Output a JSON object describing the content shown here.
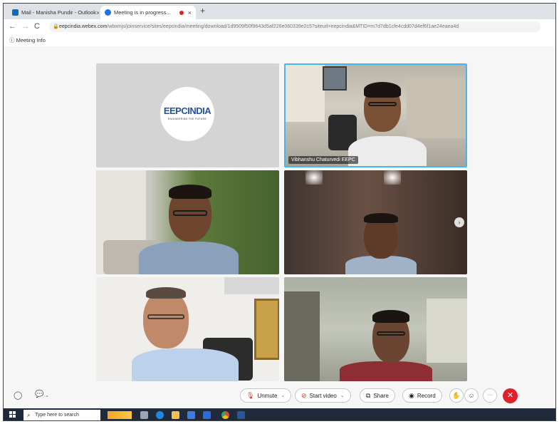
{
  "browser": {
    "tabs": [
      {
        "label": "Mail - Manisha Pundir - Outlook",
        "close": "×"
      },
      {
        "label": "Meeting is in progress...",
        "close": "×"
      }
    ],
    "new_tab": "+",
    "nav": {
      "back": "←",
      "forward": "→",
      "reload": "C"
    },
    "url_host": "eepcindia.webex.com",
    "url_path": "/wbxmjs/joinservice/sites/eepcindia/meeting/download/1d9509f50f9643d5af226e060339e2c5?siteurl=eepcindia&MTID=m7d7db1cfe4cdd07d4ef6f1ae24eaea4d",
    "meeting_info": "Meeting Info"
  },
  "meeting": {
    "logo_text": "EEPCINDIA",
    "logo_subtext": "ENGINEERING THE FUTURE",
    "active_speaker_name": "Vibhanshu Chaturvedi EEPC",
    "next_page_arrow": "›"
  },
  "toolbar": {
    "unmute": "Unmute",
    "start_video": "Start video",
    "share": "Share",
    "record": "Record",
    "more": "···",
    "leave": "✕"
  },
  "taskbar": {
    "search_placeholder": "Type here to search"
  },
  "colors": {
    "accent": "#4ab4f0",
    "leave_red": "#e0202c",
    "mute_red": "#d93025",
    "logo_blue": "#2253a5"
  }
}
